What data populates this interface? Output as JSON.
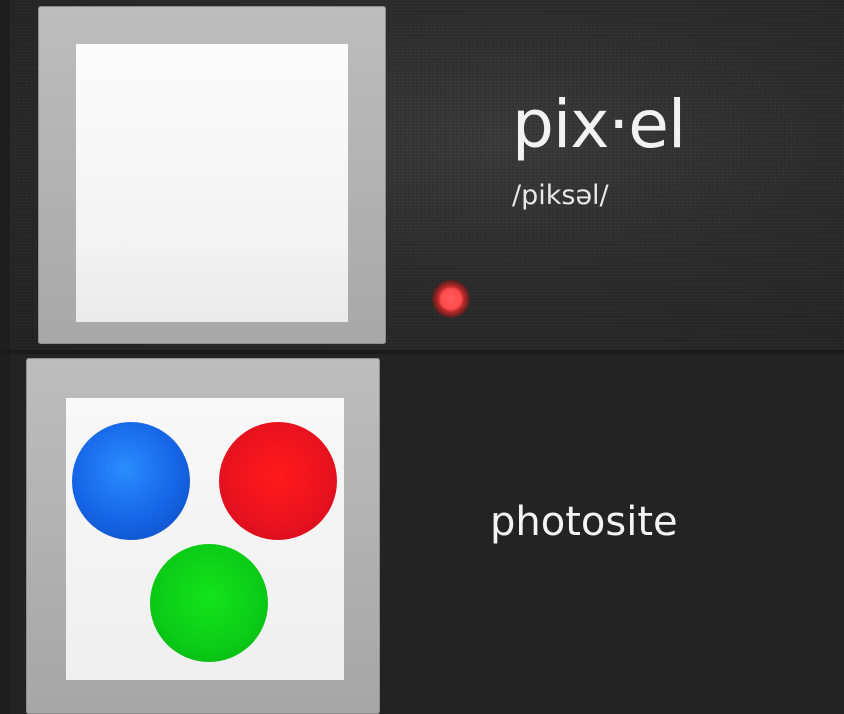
{
  "panels": {
    "top": {
      "word": "pix·el",
      "pronunciation": "/piksəl/"
    },
    "bottom": {
      "label": "photosite"
    }
  },
  "colors": {
    "background": "#232323",
    "frame": "#b3b3b3",
    "swatch_white": "#f7f7f7",
    "dot_blue": "#1565e6",
    "dot_red": "#e8121f",
    "dot_green": "#0bcc16",
    "cursor": "#ff4b4b"
  }
}
